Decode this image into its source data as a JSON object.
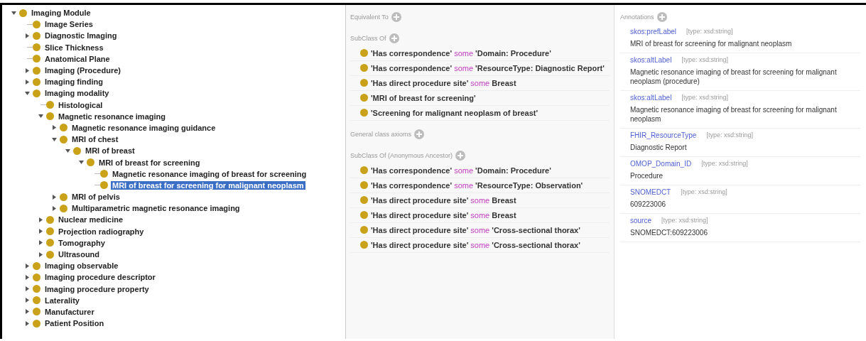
{
  "tree": [
    {
      "label": "Imaging Module",
      "kind": "branch",
      "expanded": true,
      "selected": false,
      "children": [
        {
          "label": "Image Series",
          "kind": "leaf",
          "selected": false
        },
        {
          "label": "Diagnostic Imaging",
          "kind": "branch",
          "expanded": false,
          "selected": false
        },
        {
          "label": "Slice Thickness",
          "kind": "leaf",
          "selected": false
        },
        {
          "label": "Anatomical Plane",
          "kind": "leaf",
          "selected": false
        },
        {
          "label": "Imaging (Procedure)",
          "kind": "branch",
          "expanded": false,
          "selected": false
        },
        {
          "label": "Imaging finding",
          "kind": "branch",
          "expanded": false,
          "selected": false
        },
        {
          "label": "Imaging modality",
          "kind": "branch",
          "expanded": true,
          "selected": false,
          "children": [
            {
              "label": "Histological",
              "kind": "leaf",
              "selected": false
            },
            {
              "label": "Magnetic resonance imaging",
              "kind": "branch",
              "expanded": true,
              "selected": false,
              "children": [
                {
                  "label": "Magnetic resonance imaging guidance",
                  "kind": "branch",
                  "expanded": false,
                  "selected": false
                },
                {
                  "label": "MRI of chest",
                  "kind": "branch",
                  "expanded": true,
                  "selected": false,
                  "children": [
                    {
                      "label": "MRI of breast",
                      "kind": "branch",
                      "expanded": true,
                      "selected": false,
                      "children": [
                        {
                          "label": "MRI of breast for screening",
                          "kind": "branch",
                          "expanded": true,
                          "selected": false,
                          "children": [
                            {
                              "label": "Magnetic resonance imaging of breast for screening",
                              "kind": "leaf",
                              "selected": false
                            },
                            {
                              "label": "MRI of breast for screening for malignant neoplasm",
                              "kind": "leaf",
                              "selected": true
                            }
                          ]
                        }
                      ]
                    }
                  ]
                },
                {
                  "label": "MRI of pelvis",
                  "kind": "branch",
                  "expanded": false,
                  "selected": false
                },
                {
                  "label": "Multiparametric magnetic resonance imaging",
                  "kind": "branch",
                  "expanded": false,
                  "selected": false
                }
              ]
            },
            {
              "label": "Nuclear medicine",
              "kind": "branch",
              "expanded": false,
              "selected": false
            },
            {
              "label": "Projection radiography",
              "kind": "branch",
              "expanded": false,
              "selected": false
            },
            {
              "label": "Tomography",
              "kind": "branch",
              "expanded": false,
              "selected": false
            },
            {
              "label": "Ultrasound",
              "kind": "branch",
              "expanded": false,
              "selected": false
            }
          ]
        },
        {
          "label": "Imaging observable",
          "kind": "branch",
          "expanded": false,
          "selected": false
        },
        {
          "label": "Imaging procedure descriptor",
          "kind": "branch",
          "expanded": false,
          "selected": false
        },
        {
          "label": "Imaging procedure property",
          "kind": "branch",
          "expanded": false,
          "selected": false
        },
        {
          "label": "Laterality",
          "kind": "branch",
          "expanded": false,
          "selected": false
        },
        {
          "label": "Manufacturer",
          "kind": "branch",
          "expanded": false,
          "selected": false
        },
        {
          "label": "Patient Position",
          "kind": "branch",
          "expanded": false,
          "selected": false
        }
      ]
    }
  ],
  "description": [
    {
      "title": "Equivalent To"
    },
    {
      "title": "SubClass Of",
      "items": [
        {
          "property": "'Has correspondence'",
          "keyword": "some",
          "filler": "'Domain: Procedure'"
        },
        {
          "property": "'Has correspondence'",
          "keyword": "some",
          "filler": "'ResourceType: Diagnostic Report'"
        },
        {
          "property": "'Has direct procedure site'",
          "keyword": "some",
          "filler": "Breast"
        },
        {
          "property": "'MRI of breast for screening'"
        },
        {
          "property": "'Screening for malignant neoplasm of breast'"
        }
      ]
    },
    {
      "title": "General class axioms"
    },
    {
      "title": "SubClass Of (Anonymous Ancestor)",
      "items": [
        {
          "property": "'Has correspondence'",
          "keyword": "some",
          "filler": "'Domain: Procedure'"
        },
        {
          "property": "'Has correspondence'",
          "keyword": "some",
          "filler": "'ResourceType: Observation'"
        },
        {
          "property": "'Has direct procedure site'",
          "keyword": "some",
          "filler": "Breast"
        },
        {
          "property": "'Has direct procedure site'",
          "keyword": "some",
          "filler": "Breast"
        },
        {
          "property": "'Has direct procedure site'",
          "keyword": "some",
          "filler": "'Cross-sectional thorax'"
        },
        {
          "property": "'Has direct procedure site'",
          "keyword": "some",
          "filler": "'Cross-sectional thorax'"
        }
      ]
    }
  ],
  "annotations": {
    "title": "Annotations",
    "items": [
      {
        "property": "skos:prefLabel",
        "type": "[type: xsd:string]",
        "value": "MRI of breast for screening for malignant neoplasm"
      },
      {
        "property": "skos:altLabel",
        "type": "[type: xsd:string]",
        "value": "Magnetic resonance imaging of breast for screening for malignant neoplasm (procedure)"
      },
      {
        "property": "skos:altLabel",
        "type": "[type: xsd:string]",
        "value": "Magnetic resonance imaging of breast for screening for malignant neoplasm"
      },
      {
        "property": "FHIR_ResourceType",
        "type": "[type: xsd:string]",
        "value": "Diagnostic Report"
      },
      {
        "property": "OMOP_Domain_ID",
        "type": "[type: xsd:string]",
        "value": "Procedure"
      },
      {
        "property": "SNOMEDCT",
        "type": "[type: xsd:string]",
        "value": "609223006"
      },
      {
        "property": "source",
        "type": "[type: xsd:string]",
        "value": "SNOMEDCT:609223006"
      }
    ]
  }
}
